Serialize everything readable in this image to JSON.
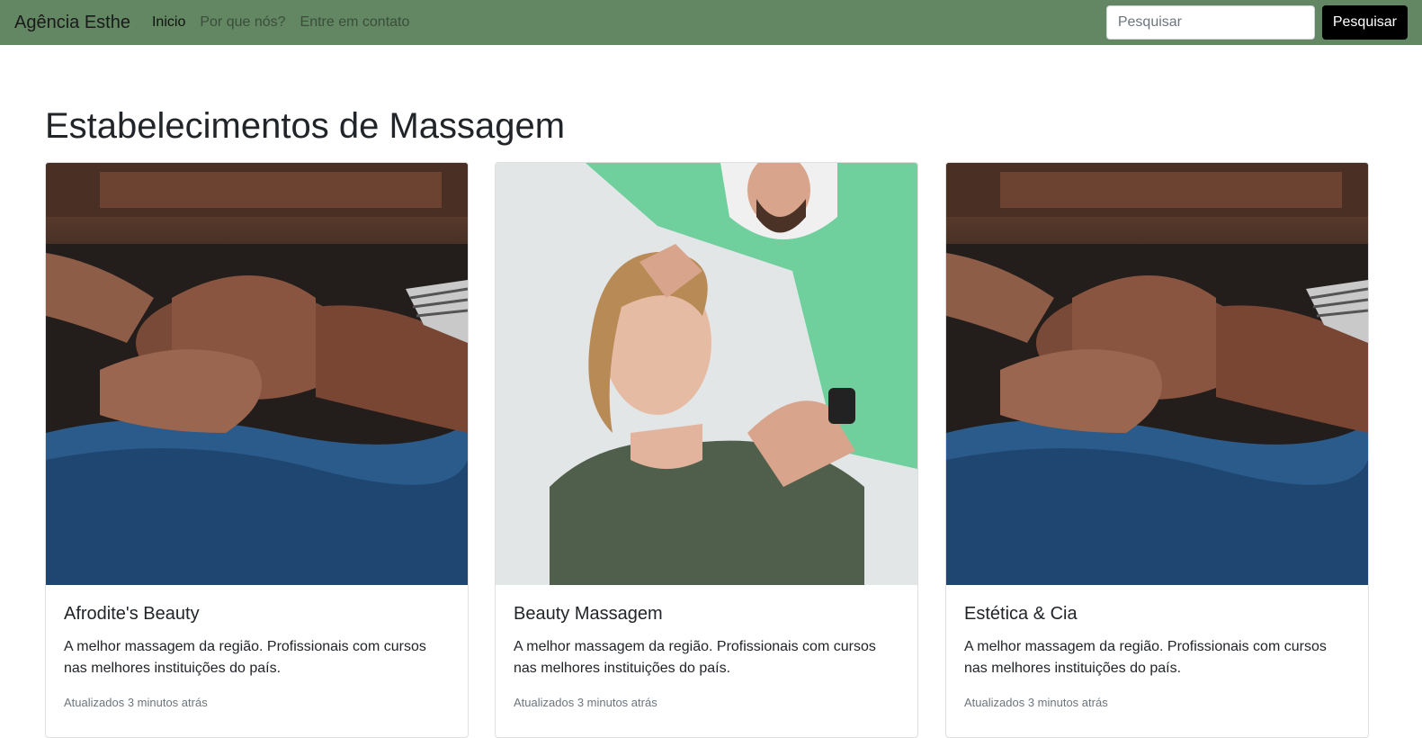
{
  "navbar": {
    "brand": "Agência Esthe",
    "links": [
      {
        "label": "Inicio",
        "active": true
      },
      {
        "label": "Por que nós?",
        "active": false
      },
      {
        "label": "Entre em contato",
        "active": false
      }
    ],
    "search_placeholder": "Pesquisar",
    "search_button": "Pesquisar"
  },
  "main": {
    "title": "Estabelecimentos de Massagem",
    "cards": [
      {
        "title": "Afrodite's Beauty",
        "text": "A melhor massagem da região. Profissionais com cursos nas melhores instituições do país.",
        "meta": "Atualizados 3 minutos atrás",
        "image": "massage-photo"
      },
      {
        "title": "Beauty Massagem",
        "text": "A melhor massagem da região. Profissionais com cursos nas melhores instituições do país.",
        "meta": "Atualizados 3 minutos atrás",
        "image": "physiotherapy-photo"
      },
      {
        "title": "Estética & Cia",
        "text": "A melhor massagem da região. Profissionais com cursos nas melhores instituições do país.",
        "meta": "Atualizados 3 minutos atrás",
        "image": "massage-photo"
      }
    ]
  },
  "colors": {
    "navbar_bg": "#628762",
    "button_bg": "#000000"
  }
}
